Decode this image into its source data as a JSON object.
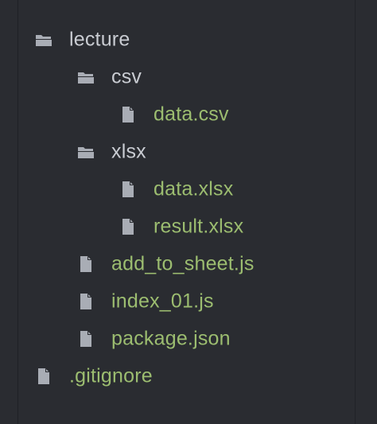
{
  "colors": {
    "background": "#2a2c31",
    "folder_text": "#c9ccd2",
    "file_text": "#9cbd70",
    "icon": "#a9adb5"
  },
  "tree": [
    {
      "type": "folder",
      "label": "lecture",
      "depth": 0,
      "icon": "folder-open-icon"
    },
    {
      "type": "folder",
      "label": "csv",
      "depth": 1,
      "icon": "folder-open-icon"
    },
    {
      "type": "file",
      "label": "data.csv",
      "depth": 2,
      "icon": "file-icon"
    },
    {
      "type": "folder",
      "label": "xlsx",
      "depth": 1,
      "icon": "folder-open-icon"
    },
    {
      "type": "file",
      "label": "data.xlsx",
      "depth": 2,
      "icon": "file-icon"
    },
    {
      "type": "file",
      "label": "result.xlsx",
      "depth": 2,
      "icon": "file-icon"
    },
    {
      "type": "file",
      "label": "add_to_sheet.js",
      "depth": 1,
      "icon": "file-icon"
    },
    {
      "type": "file",
      "label": "index_01.js",
      "depth": 1,
      "icon": "file-icon"
    },
    {
      "type": "file",
      "label": "package.json",
      "depth": 1,
      "icon": "file-icon"
    },
    {
      "type": "file",
      "label": ".gitignore",
      "depth": 0,
      "icon": "file-icon"
    }
  ]
}
